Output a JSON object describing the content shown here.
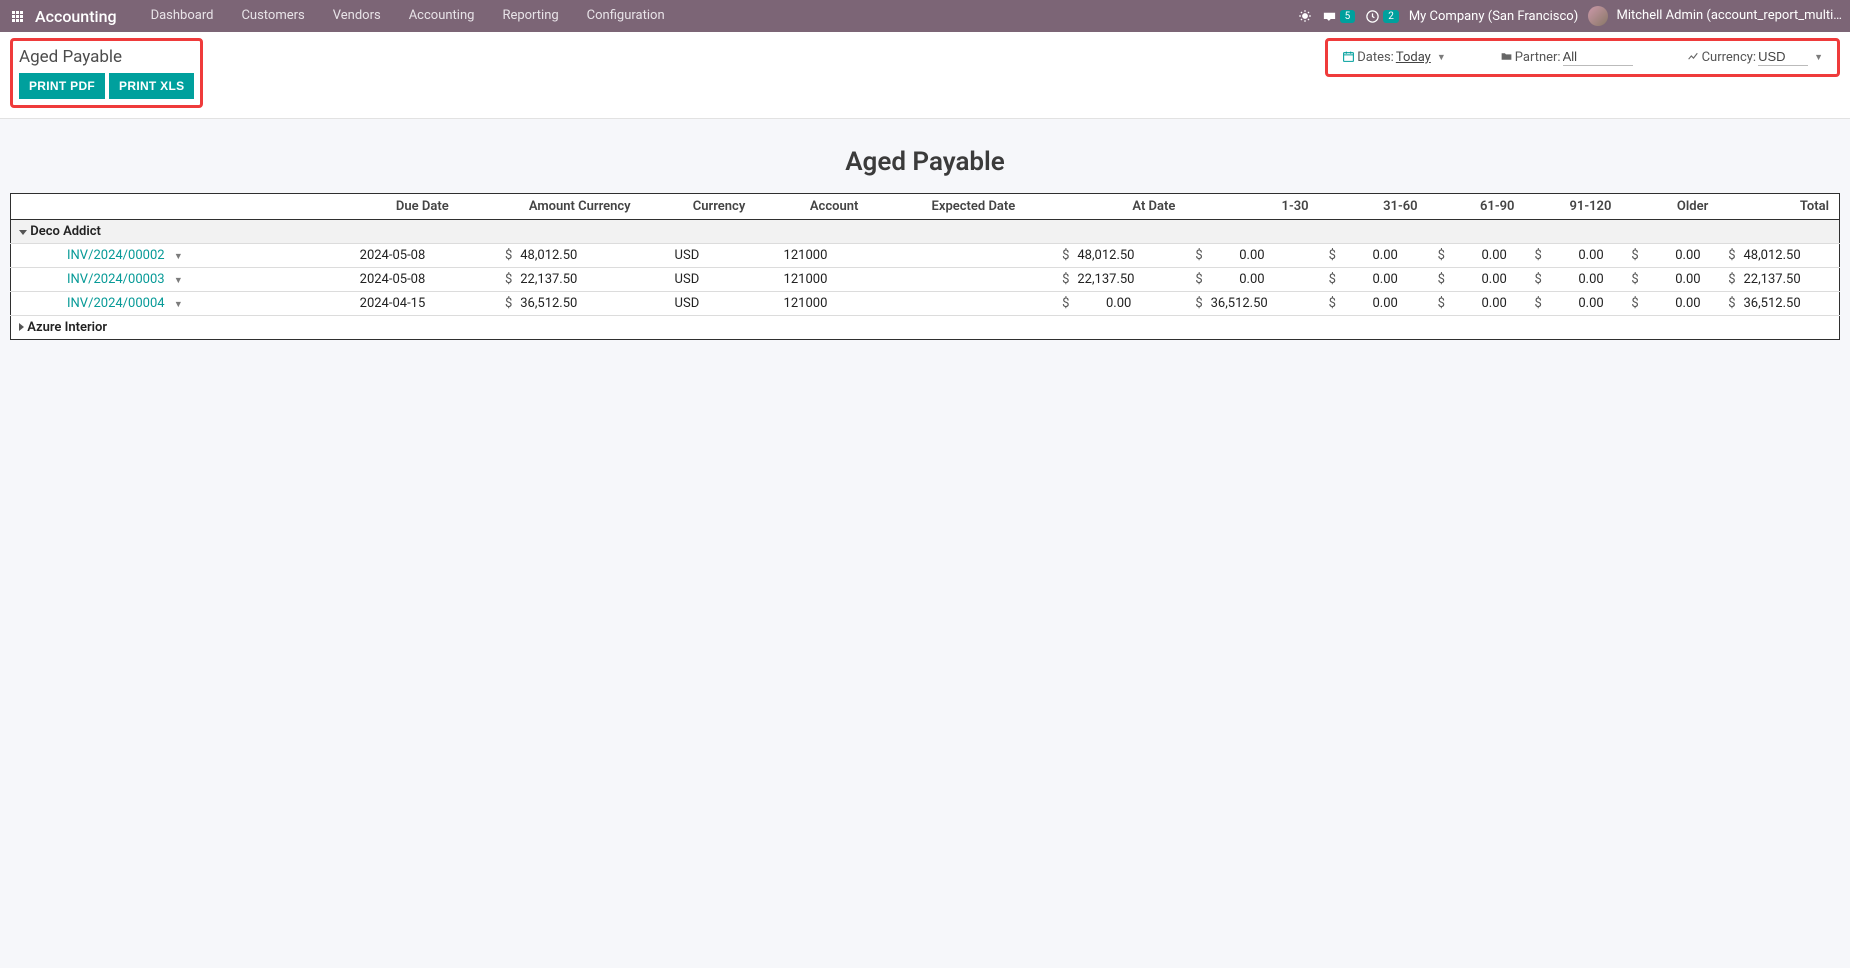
{
  "nav": {
    "brand": "Accounting",
    "menu": [
      "Dashboard",
      "Customers",
      "Vendors",
      "Accounting",
      "Reporting",
      "Configuration"
    ],
    "messages_badge": "5",
    "activities_badge": "2",
    "company": "My Company (San Francisco)",
    "user": "Mitchell Admin (account_report_multi…"
  },
  "cp": {
    "title": "Aged Payable",
    "btn_pdf": "PRINT PDF",
    "btn_xls": "PRINT XLS",
    "dates_lbl": "Dates:",
    "dates_val": "Today",
    "partner_lbl": "Partner:",
    "partner_val": "All",
    "currency_lbl": "Currency:",
    "currency_val": "USD"
  },
  "report": {
    "title": "Aged Payable",
    "cols": [
      "Due Date",
      "Amount Currency",
      "Currency",
      "Account",
      "Expected Date",
      "At Date",
      "1-30",
      "31-60",
      "61-90",
      "91-120",
      "Older",
      "Total"
    ],
    "groups": [
      {
        "name": "Deco Addict",
        "expanded": true,
        "rows": [
          {
            "inv": "INV/2024/00002",
            "due": "2024-05-08",
            "amt_cur": "48,012.50",
            "cur": "USD",
            "acc": "121000",
            "exp": "",
            "at": "48,012.50",
            "b1": "0.00",
            "b2": "0.00",
            "b3": "0.00",
            "b4": "0.00",
            "older": "0.00",
            "total": "48,012.50"
          },
          {
            "inv": "INV/2024/00003",
            "due": "2024-05-08",
            "amt_cur": "22,137.50",
            "cur": "USD",
            "acc": "121000",
            "exp": "",
            "at": "22,137.50",
            "b1": "0.00",
            "b2": "0.00",
            "b3": "0.00",
            "b4": "0.00",
            "older": "0.00",
            "total": "22,137.50"
          },
          {
            "inv": "INV/2024/00004",
            "due": "2024-04-15",
            "amt_cur": "36,512.50",
            "cur": "USD",
            "acc": "121000",
            "exp": "",
            "at": "0.00",
            "b1": "36,512.50",
            "b2": "0.00",
            "b3": "0.00",
            "b4": "0.00",
            "older": "0.00",
            "total": "36,512.50"
          }
        ]
      },
      {
        "name": "Azure Interior",
        "expanded": false,
        "rows": []
      }
    ]
  }
}
